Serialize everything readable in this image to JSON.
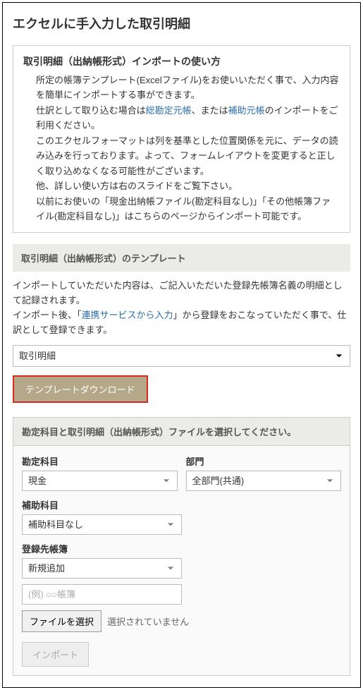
{
  "page_title": "エクセルに手入力した取引明細",
  "info": {
    "title": "取引明細（出納帳形式）インポートの使い方",
    "p1_a": "所定の帳簿テンプレート(Excelファイル)をお使いいただく事で、入力内容を簡単にインポートする事ができます。",
    "p2_a": "仕訳として取り込む場合は",
    "link1": "総勘定元帳",
    "p2_b": "、または",
    "link2": "補助元帳",
    "p2_c": "のインポートをご利用ください。",
    "p3": "このエクセルフォーマットは列を基準とした位置関係を元に、データの読み込みを行っております。よって、フォームレイアウトを変更すると正しく取り込めなくなる可能性がございます。",
    "p4": "他、詳しい使い方は右のスライドをご覧下さい。",
    "p5": "以前にお使いの「現金出納帳ファイル(勘定科目なし)」「その他帳簿ファイル(勘定科目なし)」はこちらのページからインポート可能です。"
  },
  "template_section": {
    "header": "取引明細（出納帳形式）のテンプレート",
    "desc_a": "インポートしていただいた内容は、ご記入いただいた登録先帳簿名義の明細として記録されます。",
    "desc_b": "インポート後、「",
    "link": "連携サービスから入力",
    "desc_c": "」から登録をおこなっていただく事で、仕訳として登録できます。",
    "select_value": "取引明細",
    "download_label": "テンプレートダウンロード"
  },
  "form": {
    "header": "勘定科目と取引明細（出納帳形式）ファイルを選択してください。",
    "account_label": "勘定科目",
    "account_value": "現金",
    "dept_label": "部門",
    "dept_value": "全部門(共通)",
    "sub_label": "補助科目",
    "sub_value": "補助科目なし",
    "ledger_label": "登録先帳簿",
    "ledger_value": "新規追加",
    "ledger_placeholder": "(例) ○○帳簿",
    "file_button": "ファイルを選択",
    "file_status": "選択されていません",
    "import_button": "インポート"
  }
}
